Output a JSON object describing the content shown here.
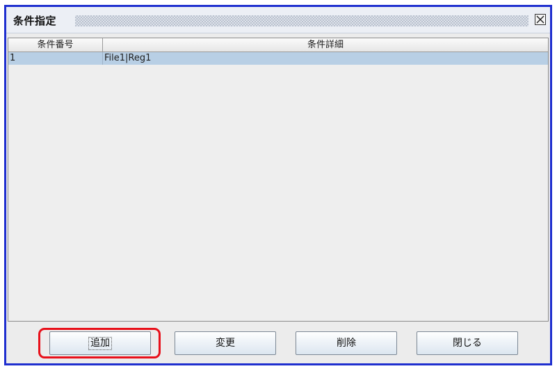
{
  "dialog": {
    "title": "条件指定",
    "close_icon": "close-icon"
  },
  "table": {
    "columns": [
      "条件番号",
      "条件詳細"
    ],
    "rows": [
      {
        "number": "1",
        "detail": "File1|Reg1",
        "selected": true
      }
    ]
  },
  "buttons": {
    "add": "追加",
    "change": "変更",
    "delete": "削除",
    "close": "閉じる"
  },
  "colors": {
    "border": "#1f2fcf",
    "selected_row": "#b8cfe5",
    "highlight": "#e8101a"
  }
}
